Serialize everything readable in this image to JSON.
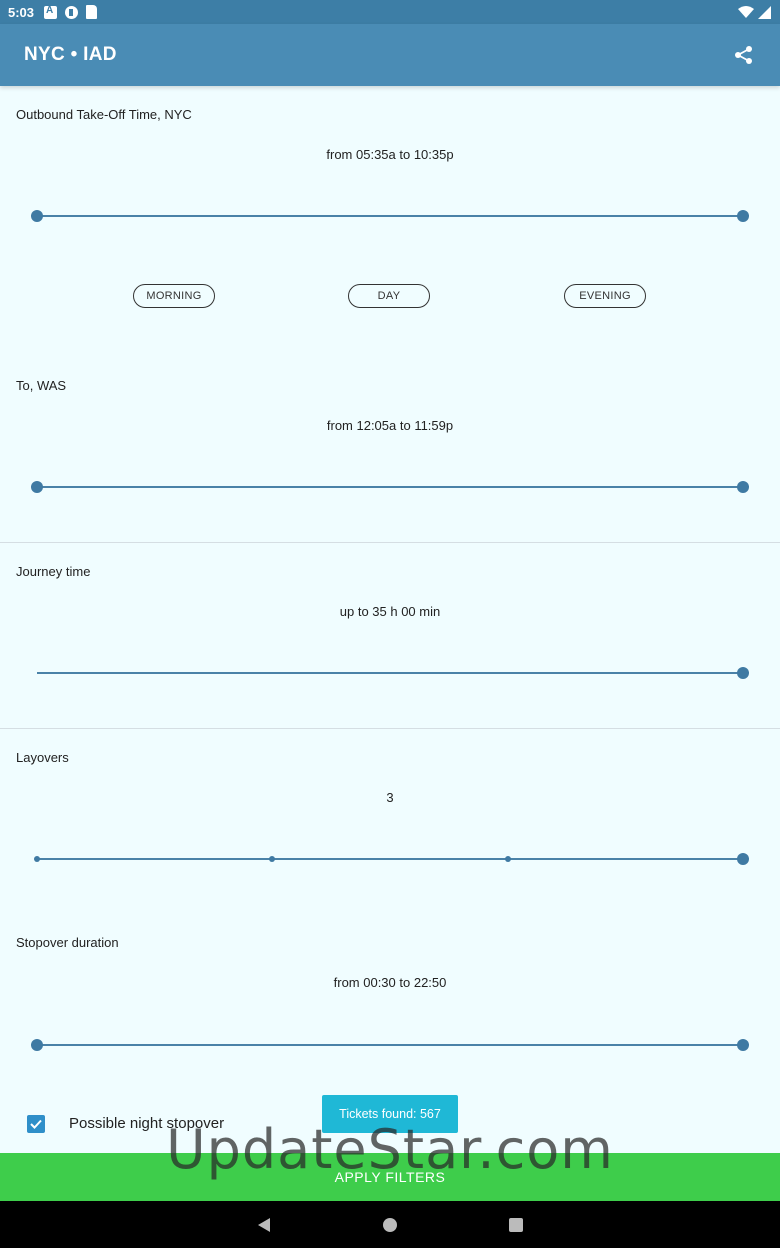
{
  "status_bar": {
    "time": "5:03"
  },
  "app_bar": {
    "title": "NYC • IAD"
  },
  "outbound": {
    "label": "Outbound Take-Off Time, NYC",
    "range": "from 05:35a to 10:35p",
    "slider": {
      "low": 0,
      "high": 1
    },
    "chips": {
      "morning": "MORNING",
      "day": "DAY",
      "evening": "EVENING"
    }
  },
  "arrival": {
    "label": "To, WAS",
    "range": "from 12:05a to 11:59p",
    "slider": {
      "low": 0,
      "high": 1
    }
  },
  "journey": {
    "label": "Journey time",
    "value": "up to 35 h 00 min",
    "slider": {
      "value": 1
    }
  },
  "layovers": {
    "label": "Layovers",
    "value": "3",
    "slider": {
      "steps": 4,
      "value": 3
    }
  },
  "stopover": {
    "label": "Stopover duration",
    "range": "from 00:30 to 22:50",
    "slider": {
      "low": 0,
      "high": 1
    }
  },
  "night_stopover": {
    "label": "Possible night stopover",
    "checked": true
  },
  "toast": {
    "text": "Tickets found: 567"
  },
  "apply_button": {
    "label": "APPLY FILTERS"
  },
  "watermark": "UpdateStar.com",
  "colors": {
    "app_bar": "#4a8cb5",
    "accent": "#3f7aa3",
    "apply": "#3ecd4b",
    "toast": "#1fb8d6",
    "background": "#f0fdff"
  }
}
